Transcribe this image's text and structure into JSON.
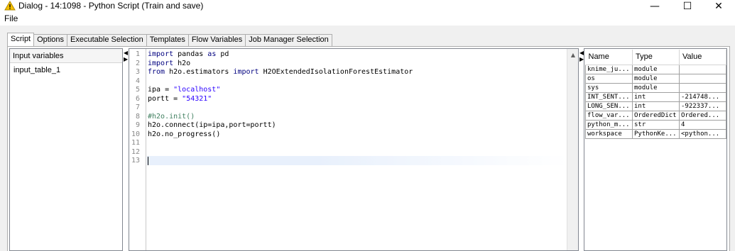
{
  "window": {
    "title": "Dialog - 14:1098 - Python Script (Train and save)",
    "minimize_glyph": "—",
    "maximize_glyph": "☐",
    "close_glyph": "✕"
  },
  "menu": {
    "file": "File"
  },
  "tabs": [
    {
      "label": "Script"
    },
    {
      "label": "Options"
    },
    {
      "label": "Executable Selection"
    },
    {
      "label": "Templates"
    },
    {
      "label": "Flow Variables"
    },
    {
      "label": "Job Manager Selection"
    }
  ],
  "input_variables": {
    "header": "Input variables",
    "items": [
      "input_table_1"
    ]
  },
  "editor": {
    "line_numbers": [
      "1",
      "2",
      "3",
      "4",
      "5",
      "6",
      "7",
      "8",
      "9",
      "10",
      "11",
      "12",
      "13"
    ]
  },
  "variables_table": {
    "columns": [
      "Name",
      "Type",
      "Value"
    ],
    "rows": [
      [
        "knime_ju...",
        "module",
        ""
      ],
      [
        "os",
        "module",
        ""
      ],
      [
        "sys",
        "module",
        ""
      ],
      [
        "INT_SENT...",
        "int",
        "-214748..."
      ],
      [
        "LONG_SEN...",
        "int",
        "-922337..."
      ],
      [
        "flow_var...",
        "OrderedDict",
        "Ordered..."
      ],
      [
        "python_m...",
        "str",
        "4"
      ],
      [
        "workspace",
        "PythonKe...",
        "<python..."
      ]
    ]
  },
  "colors": {
    "keyword": "#00007f",
    "string": "#2a00ff",
    "comment": "#3f7f5f",
    "warning_icon": "#f5c000"
  }
}
